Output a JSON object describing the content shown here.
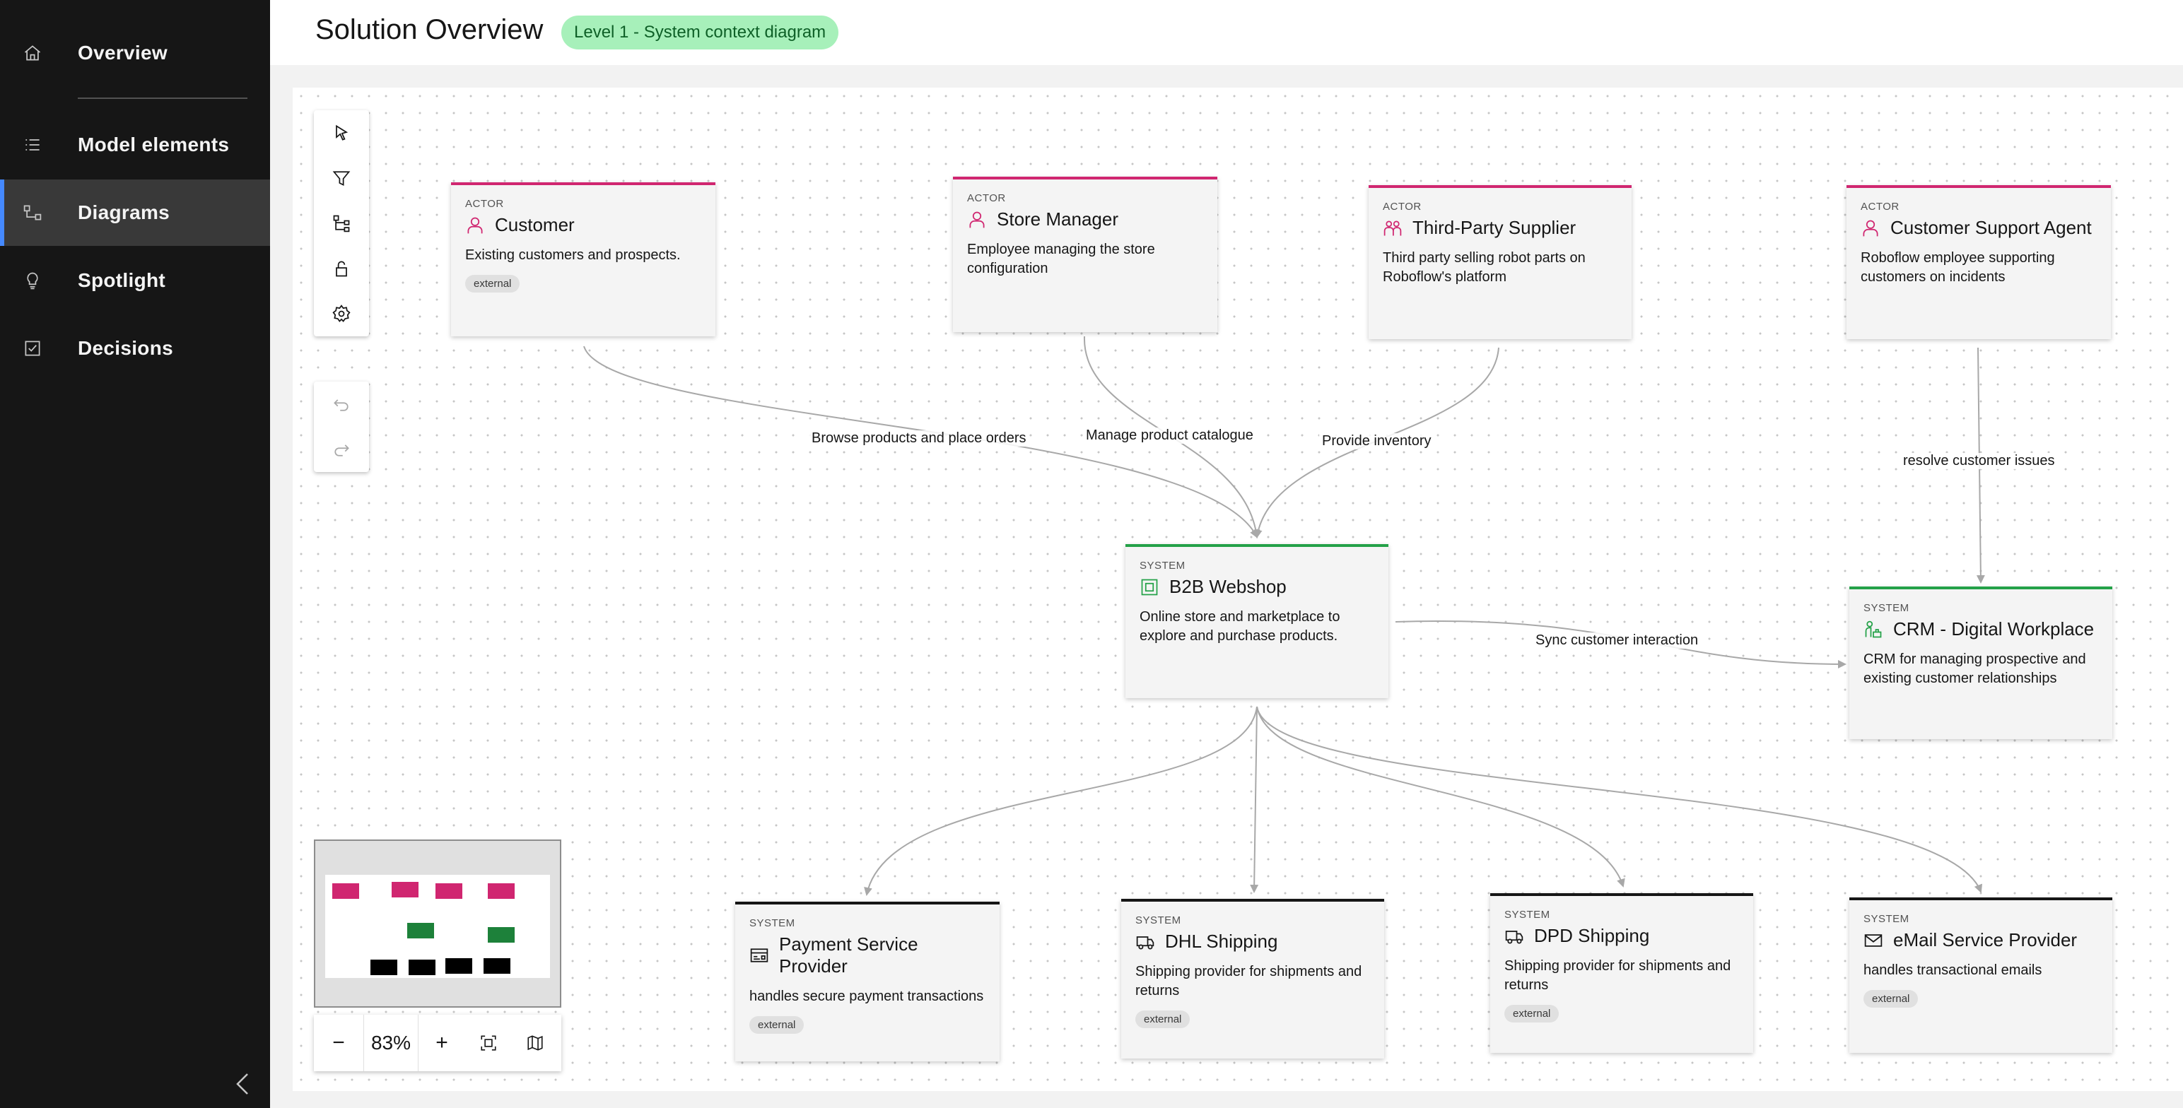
{
  "sidebar": {
    "items": [
      {
        "label": "Overview",
        "icon": "home-icon"
      },
      {
        "label": "Model elements",
        "icon": "list-icon"
      },
      {
        "label": "Diagrams",
        "icon": "diagram-icon",
        "active": true
      },
      {
        "label": "Spotlight",
        "icon": "lightbulb-icon"
      },
      {
        "label": "Decisions",
        "icon": "checkbox-icon"
      }
    ],
    "collapse_icon": "chevron-left-icon"
  },
  "header": {
    "title": "Solution Overview",
    "badge": "Level 1 - System context diagram"
  },
  "toolbar": {
    "tools": [
      "pointer-icon",
      "filter-icon",
      "tree-icon",
      "unlock-icon",
      "settings-icon"
    ],
    "history": [
      "undo-icon",
      "redo-icon"
    ]
  },
  "zoom": {
    "minus": "−",
    "value": "83%",
    "plus": "+",
    "fit_icon": "fit-to-screen-icon",
    "map_icon": "map-icon"
  },
  "colors": {
    "actor": "#d02670",
    "internal_system": "#24a148",
    "external_system": "#161616",
    "badge_bg": "#a7f0ba",
    "nav_active_accent": "#4589ff"
  },
  "nodes": {
    "customer": {
      "type": "ACTOR",
      "title": "Customer",
      "desc": "Existing customers and prospects.",
      "tag": "external",
      "icon": "user-icon"
    },
    "store_manager": {
      "type": "ACTOR",
      "title": "Store Manager",
      "desc": "Employee managing the store configuration",
      "icon": "user-icon"
    },
    "supplier": {
      "type": "ACTOR",
      "title": "Third-Party Supplier",
      "desc": "Third party selling robot parts on Roboflow's platform",
      "icon": "users-icon"
    },
    "support_agent": {
      "type": "ACTOR",
      "title": "Customer Support Agent",
      "desc": "Roboflow employee supporting customers on incidents",
      "icon": "user-icon"
    },
    "webshop": {
      "type": "SYSTEM",
      "title": "B2B Webshop",
      "desc": "Online store and marketplace to explore and purchase products.",
      "icon": "application-icon"
    },
    "crm": {
      "type": "SYSTEM",
      "title": "CRM - Digital Workplace",
      "desc": "CRM for managing prospective and existing customer relationships",
      "icon": "workplace-icon"
    },
    "payment": {
      "type": "SYSTEM",
      "title": "Payment Service Provider",
      "desc": "handles secure payment transactions",
      "tag": "external",
      "icon": "payment-icon"
    },
    "dhl": {
      "type": "SYSTEM",
      "title": "DHL Shipping",
      "desc": "Shipping provider for shipments and returns",
      "tag": "external",
      "icon": "delivery-truck-icon"
    },
    "dpd": {
      "type": "SYSTEM",
      "title": "DPD Shipping",
      "desc": "Shipping provider for shipments and returns",
      "tag": "external",
      "icon": "delivery-truck-icon"
    },
    "email": {
      "type": "SYSTEM",
      "title": "eMail Service Provider",
      "desc": "handles transactional emails",
      "tag": "external",
      "icon": "email-icon"
    }
  },
  "edges": {
    "browse": "Browse products and place orders",
    "manage": "Manage product catalogue",
    "provide": "Provide inventory",
    "resolve": "resolve customer issues",
    "sync": "Sync customer interaction"
  }
}
